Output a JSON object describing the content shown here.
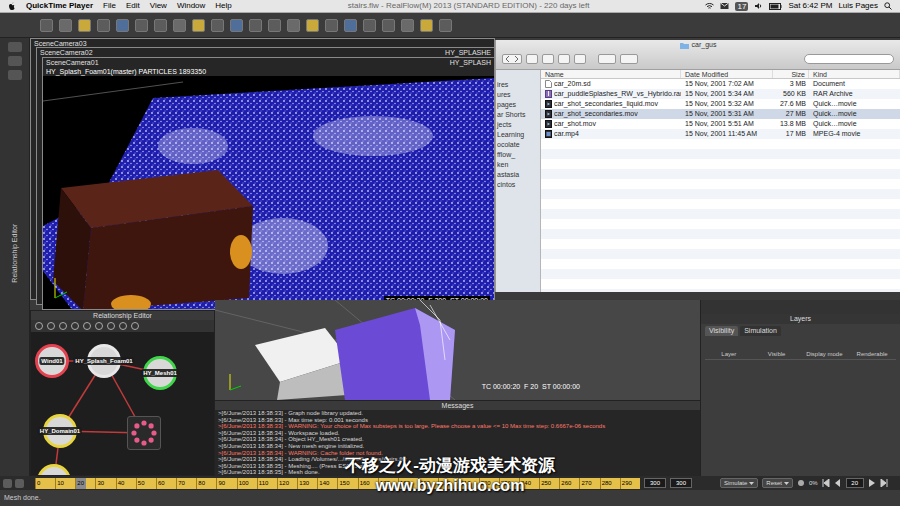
{
  "menu_bar": {
    "app": "QuickTime Player",
    "menus": [
      "File",
      "Edit",
      "View",
      "Window",
      "Help"
    ],
    "window_title": "stairs.flw - RealFlow(M) 2013 (STANDARD EDITION) - 220 days left",
    "badge": "17",
    "clock": "Sat 6:42 PM",
    "user": "Luis Pages"
  },
  "side_label": "Relationship Editor",
  "viewport_stack": [
    {
      "camera": "SceneCamera03"
    },
    {
      "camera": "SceneCamera02",
      "object": "HY_SPLASHE"
    },
    {
      "camera": "SceneCamera01",
      "object": "HY_SPLASH"
    }
  ],
  "main_viewport": {
    "info": "HY_Splash_Foam01(master) PARTICLES 1893350",
    "timecode": "TC 00:00:20  F 200  ST 00:00:00"
  },
  "finder": {
    "title": "car_gus",
    "sidebar": [
      "ires",
      "ures",
      "pages",
      "ar Shorts",
      "jects",
      "Learning",
      "ocolate",
      "fflow_",
      "ken",
      "astasia",
      "cintos"
    ],
    "columns": [
      "Name",
      "Date Modified",
      "Size",
      "Kind"
    ],
    "rows": [
      {
        "kind": "document",
        "cells": [
          "car_20m.sd",
          "15 Nov, 2001 7:02 AM",
          "3 MB",
          "Document"
        ],
        "selected": false
      },
      {
        "kind": "archive",
        "cells": [
          "car_puddleSplashes_RW_vs_Hybrido.rar",
          "15 Nov, 2001 5:34 AM",
          "560 KB",
          "RAR Archive"
        ],
        "selected": false
      },
      {
        "kind": "movie",
        "cells": [
          "car_shot_secondaries_liquid.mov",
          "15 Nov, 2001 5:32 AM",
          "27.6 MB",
          "Quick…movie"
        ],
        "selected": false
      },
      {
        "kind": "movie",
        "cells": [
          "car_shot_secondaries.mov",
          "15 Nov, 2001 5:31 AM",
          "27 MB",
          "Quick…movie"
        ],
        "selected": true
      },
      {
        "kind": "movie",
        "cells": [
          "car_shot.mov",
          "15 Nov, 2001 5:51 AM",
          "13.8 MB",
          "Quick…movie"
        ],
        "selected": false
      },
      {
        "kind": "video",
        "cells": [
          "car.mp4",
          "15 Nov, 2001 11:45 AM",
          "17 MB",
          "MPEG-4 movie"
        ],
        "selected": false
      }
    ]
  },
  "relationship_editor": {
    "title": "Relationship Editor",
    "nodes": [
      {
        "kind": "node",
        "label": "Wind01",
        "color": "#e5414f"
      },
      {
        "kind": "node",
        "label": "HY_Splash_Foam01",
        "color": "#e8e8e8"
      },
      {
        "kind": "node",
        "label": "HY_Mesh01",
        "color": "#3fd64a"
      },
      {
        "kind": "node",
        "label": "HY_Domain01",
        "color": "#e8d43c"
      },
      {
        "kind": "group",
        "color": "#e85a8c"
      },
      {
        "kind": "node",
        "color": "#e8d43c"
      }
    ],
    "links": [
      [
        0,
        1
      ],
      [
        2,
        1
      ],
      [
        3,
        1
      ],
      [
        4,
        1
      ],
      [
        3,
        4
      ],
      [
        5,
        3
      ]
    ]
  },
  "preview": {
    "timecode": "TC 00:00:20  F 20  ST 00:00:00"
  },
  "layers": {
    "title": "Layers",
    "tabs": [
      {
        "label": "Visibility",
        "selected": true
      },
      {
        "label": "Simulation",
        "selected": false
      }
    ],
    "columns": [
      "Layer",
      "Visible",
      "Display mode",
      "Renderable"
    ]
  },
  "messages": {
    "title": "Messages",
    "lines": [
      {
        "kind": "info",
        "text": ">[6/June/2013 18:38:33] - Graph node library updated."
      },
      {
        "kind": "info",
        "text": ">[6/June/2013 18:38:33] - Max time step: 0.001 seconds"
      },
      {
        "kind": "warning",
        "text": ">[6/June/2013 18:38:33] - WARNING: Your choice of Max substeps is too large. Please choose a value <= 10 Max time step: 0.6667e-06 seconds"
      },
      {
        "kind": "info",
        "text": ">[6/June/2013 18:38:34] - Workspace loaded."
      },
      {
        "kind": "info",
        "text": ">[6/June/2013 18:38:34] - Object HY_Mesh01 created."
      },
      {
        "kind": "info",
        "text": ">[6/June/2013 18:38:34] - New mesh engine initialized."
      },
      {
        "kind": "warning",
        "text": ">[6/June/2013 18:38:34] - WARNING: Cache folder not found."
      },
      {
        "kind": "info",
        "text": ">[6/June/2013 18:38:34] - Loading /Volumes/.../stairs/flw_files/stairs.flw"
      },
      {
        "kind": "info",
        "text": ">[6/June/2013 18:38:35] - Meshing.... (Press ESC to abort)"
      },
      {
        "kind": "info",
        "text": ">[6/June/2013 18:38:35] - Mesh done."
      }
    ]
  },
  "timeline": {
    "ticks": [
      "0",
      "10",
      "20",
      "30",
      "40",
      "50",
      "60",
      "70",
      "80",
      "90",
      "100",
      "110",
      "120",
      "130",
      "140",
      "150",
      "160",
      "170",
      "180",
      "190",
      "200",
      "210",
      "220",
      "230",
      "240",
      "250",
      "260",
      "270",
      "280",
      "290"
    ],
    "level": 0.0667,
    "fields": [
      "300",
      "300"
    ],
    "buttons": [
      "Simulate",
      "Reset"
    ],
    "progress": "0%",
    "frame": "20"
  },
  "status_bar": "Mesh done.",
  "watermark": [
    "不移之火-动漫游戏美术资源",
    "www.byzhihuo.com"
  ]
}
